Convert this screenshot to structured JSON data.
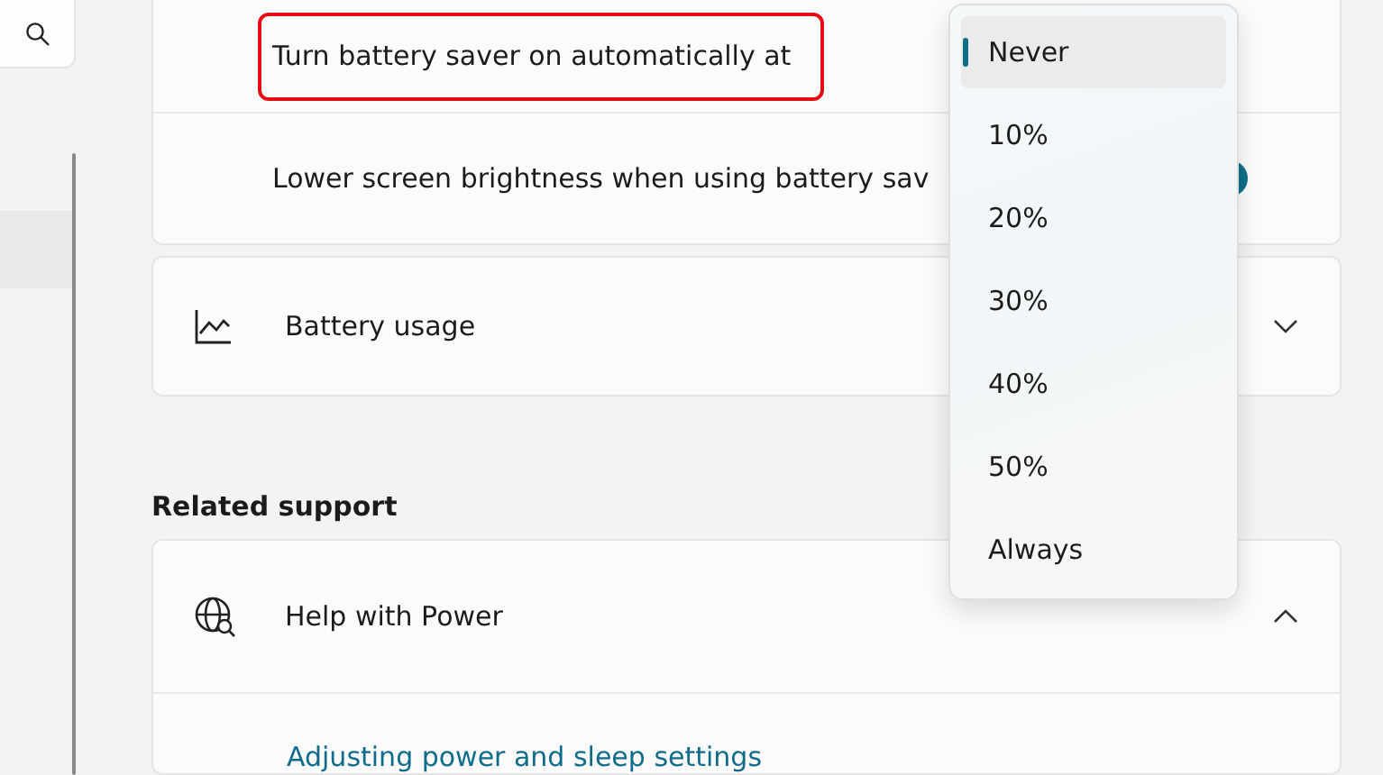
{
  "battery_saver_card": {
    "rows": [
      {
        "label": "Turn battery saver on automatically at",
        "highlighted": true
      },
      {
        "label": "Lower screen brightness when using battery sav",
        "toggle_on": true
      }
    ]
  },
  "battery_usage": {
    "label": "Battery usage",
    "expanded": false
  },
  "related_support": {
    "heading": "Related support",
    "help": {
      "label": "Help with Power",
      "expanded": true,
      "links": [
        "Adjusting power and sleep settings"
      ]
    }
  },
  "dropdown": {
    "options": [
      {
        "label": "Never",
        "selected": true
      },
      {
        "label": "10%",
        "selected": false
      },
      {
        "label": "20%",
        "selected": false
      },
      {
        "label": "30%",
        "selected": false
      },
      {
        "label": "40%",
        "selected": false
      },
      {
        "label": "50%",
        "selected": false
      },
      {
        "label": "Always",
        "selected": false
      }
    ]
  }
}
